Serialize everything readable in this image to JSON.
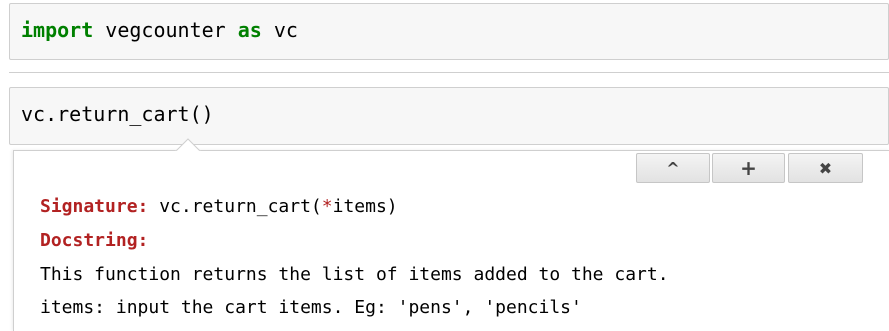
{
  "cells": [
    {
      "keyword_import": "import",
      "module": " vegcounter ",
      "keyword_as": "as",
      "alias": " vc"
    },
    {
      "code": "vc.return_cart()"
    }
  ],
  "tooltip": {
    "buttons": {
      "collapse": "^",
      "expand": "+",
      "close": "✖"
    },
    "signature_label": "Signature:",
    "signature_prefix": " vc.return_cart(",
    "signature_star": "*",
    "signature_suffix": "items)",
    "docstring_label": "Docstring:",
    "doc_lines": [
      "This function returns the list of items added to the cart.",
      "items: input the cart items. Eg: 'pens', 'pencils'"
    ]
  },
  "colors": {
    "keyword": "#008000",
    "label": "#b22222",
    "cell_bg": "#f7f7f7",
    "border": "#cfcfcf"
  }
}
